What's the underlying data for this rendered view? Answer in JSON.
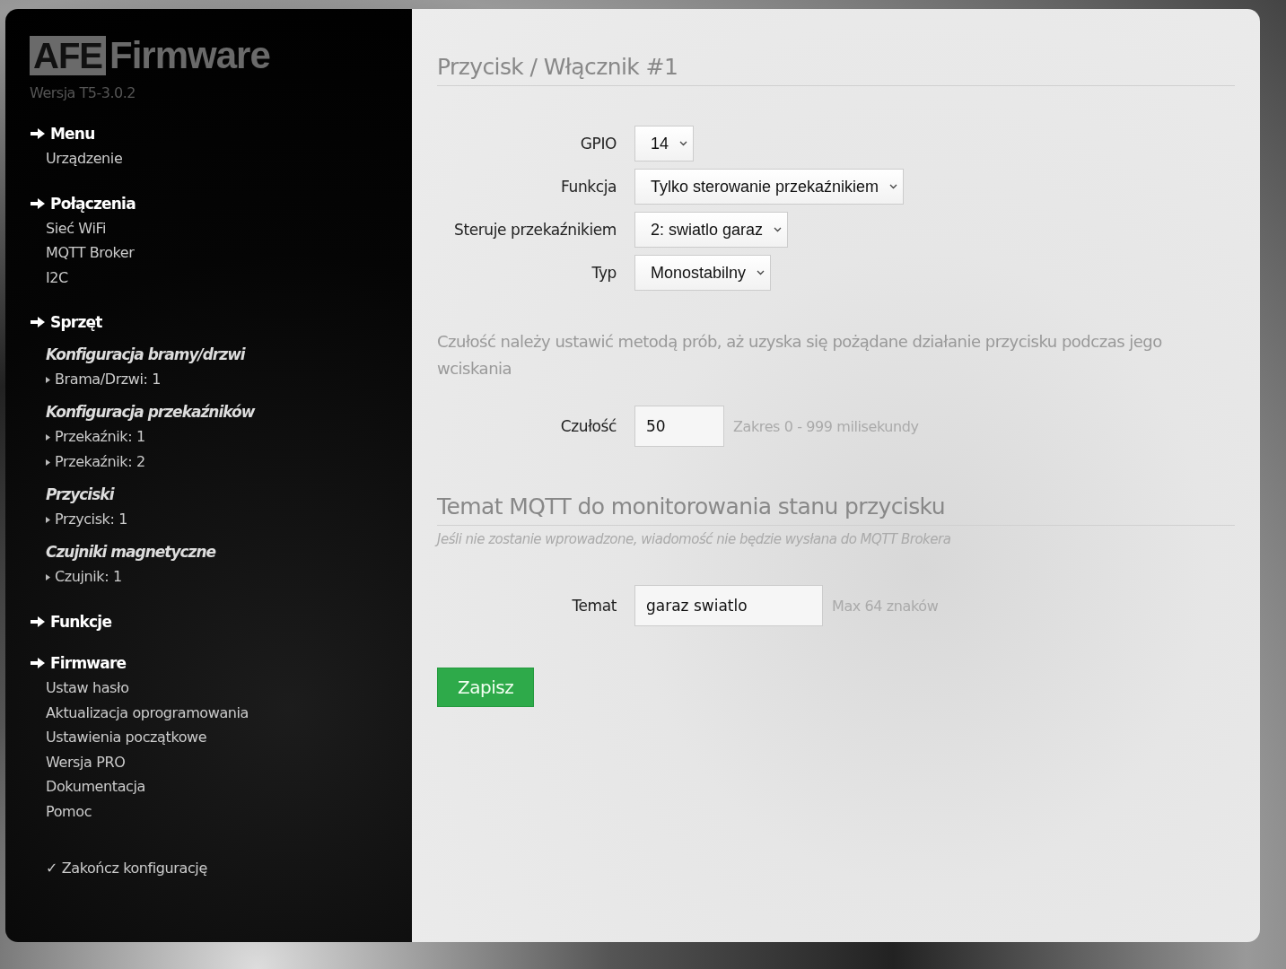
{
  "logo": {
    "badge": "AFE",
    "name": "Firmware"
  },
  "version": "Wersja T5-3.0.2",
  "sidebar": [
    {
      "title": "Menu",
      "items": [
        {
          "kind": "link",
          "label": "Urządzenie"
        }
      ]
    },
    {
      "title": "Połączenia",
      "items": [
        {
          "kind": "link",
          "label": "Sieć WiFi"
        },
        {
          "kind": "link",
          "label": "MQTT Broker"
        },
        {
          "kind": "link",
          "label": "I2C"
        }
      ]
    },
    {
      "title": "Sprzęt",
      "items": [
        {
          "kind": "group",
          "label": "Konfiguracja bramy/drzwi"
        },
        {
          "kind": "sub",
          "label": "Brama/Drzwi: 1"
        },
        {
          "kind": "group",
          "label": "Konfiguracja przekaźników"
        },
        {
          "kind": "sub",
          "label": "Przekaźnik: 1"
        },
        {
          "kind": "sub",
          "label": "Przekaźnik: 2"
        },
        {
          "kind": "group",
          "label": "Przyciski"
        },
        {
          "kind": "sub",
          "label": "Przycisk: 1"
        },
        {
          "kind": "group",
          "label": "Czujniki magnetyczne"
        },
        {
          "kind": "sub",
          "label": "Czujnik: 1"
        }
      ]
    },
    {
      "title": "Funkcje"
    },
    {
      "title": "Firmware",
      "items": [
        {
          "kind": "link",
          "label": "Ustaw hasło"
        },
        {
          "kind": "link",
          "label": "Aktualizacja oprogramowania"
        },
        {
          "kind": "link",
          "label": "Ustawienia początkowe"
        },
        {
          "kind": "link",
          "label": "Wersja PRO"
        },
        {
          "kind": "link",
          "label": "Dokumentacja"
        },
        {
          "kind": "link",
          "label": "Pomoc"
        }
      ]
    }
  ],
  "finish_link": "✓ Zakończ konfigurację",
  "page_title": "Przycisk / Włącznik #1",
  "fields": [
    {
      "kind": "select",
      "label": "GPIO",
      "value": "14"
    },
    {
      "kind": "select",
      "label": "Funkcja",
      "value": "Tylko sterowanie przekaźnikiem"
    },
    {
      "kind": "select",
      "label": "Steruje przekaźnikiem",
      "value": "2: swiatlo garaz"
    },
    {
      "kind": "select",
      "label": "Typ",
      "value": "Monostabilny"
    }
  ],
  "sensitivity_note": "Czułość należy ustawić metodą prób, aż uzyska się pożądane działanie przycisku podczas jego wciskania",
  "sensitivity": {
    "kind": "input",
    "label": "Czułość",
    "value": "50",
    "hint": "Zakres 0 - 999 milisekundy"
  },
  "mqtt": {
    "title": "Temat MQTT do monitorowania stanu przycisku",
    "note": "Jeśli nie zostanie wprowadzone, wiadomość nie będzie wysłana do MQTT Brokera",
    "field": {
      "kind": "input",
      "label": "Temat",
      "value": "garaz swiatlo",
      "hint": "Max 64 znaków"
    }
  },
  "save_button": "Zapisz"
}
